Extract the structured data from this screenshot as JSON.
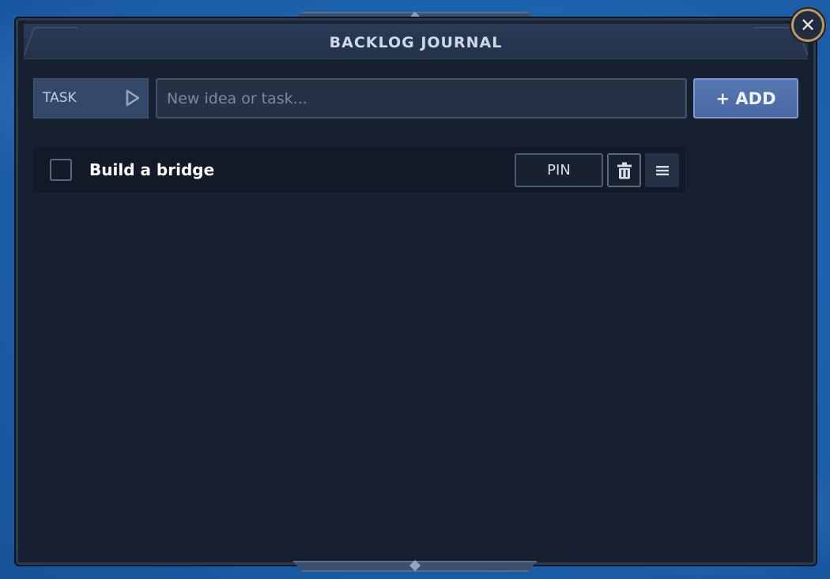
{
  "panel": {
    "title": "BACKLOG JOURNAL",
    "close_icon": "close-icon",
    "close_glyph": "✕"
  },
  "composer": {
    "type_label": "TASK",
    "type_icon": "play-triangle-icon",
    "input_value": "",
    "input_placeholder": "New idea or task...",
    "add_label": "+ ADD"
  },
  "tasks": [
    {
      "label": "Build a bridge",
      "checked": false,
      "pin_label": "PIN",
      "delete_icon": "trash-icon",
      "drag_icon": "hamburger-menu-icon"
    }
  ],
  "colors": {
    "panel_bg": "#16202e",
    "header_bg": "#293b57",
    "accent_blue": "#5677b3",
    "close_ring": "#b8996a"
  }
}
